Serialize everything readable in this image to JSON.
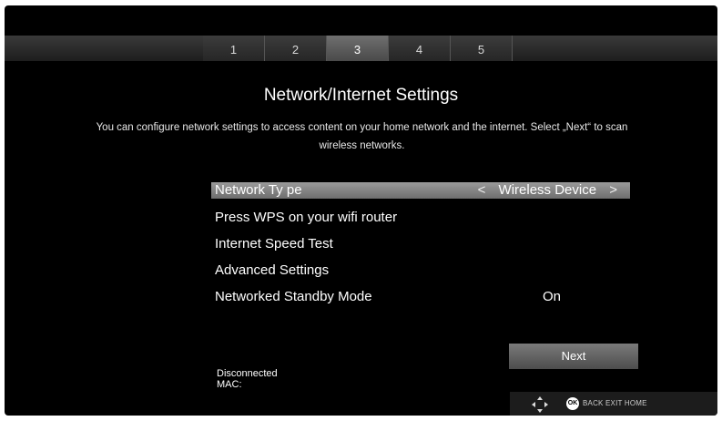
{
  "steps": [
    "1",
    "2",
    "3",
    "4",
    "5"
  ],
  "active_step": 3,
  "title": "Network/Internet Settings",
  "description": "You can configure network settings to access content on your home network and the internet. Select „Next“ to scan wireless networks.",
  "menu": [
    {
      "label": "Network Ty pe",
      "value": "Wireless Device",
      "selected": true,
      "has_arrows": true
    },
    {
      "label": "Press WPS on your wifi router",
      "value": ""
    },
    {
      "label": "Internet Speed Test",
      "value": ""
    },
    {
      "label": "Advanced Settings",
      "value": ""
    },
    {
      "label": "Networked Standby Mode",
      "value": "On"
    }
  ],
  "arrows": {
    "left": "<",
    "right": ">"
  },
  "next_label": "Next",
  "status": {
    "connection": "Disconnected",
    "mac": "MAC:"
  },
  "footer": {
    "ok": "OK",
    "keys": "BACK EXIT HOME"
  },
  "icons": [
    "navigation-pad-icon",
    "ok-icon"
  ],
  "colors": {
    "background": "#000000",
    "highlight": "#8a8a8a",
    "button": "#666666"
  }
}
